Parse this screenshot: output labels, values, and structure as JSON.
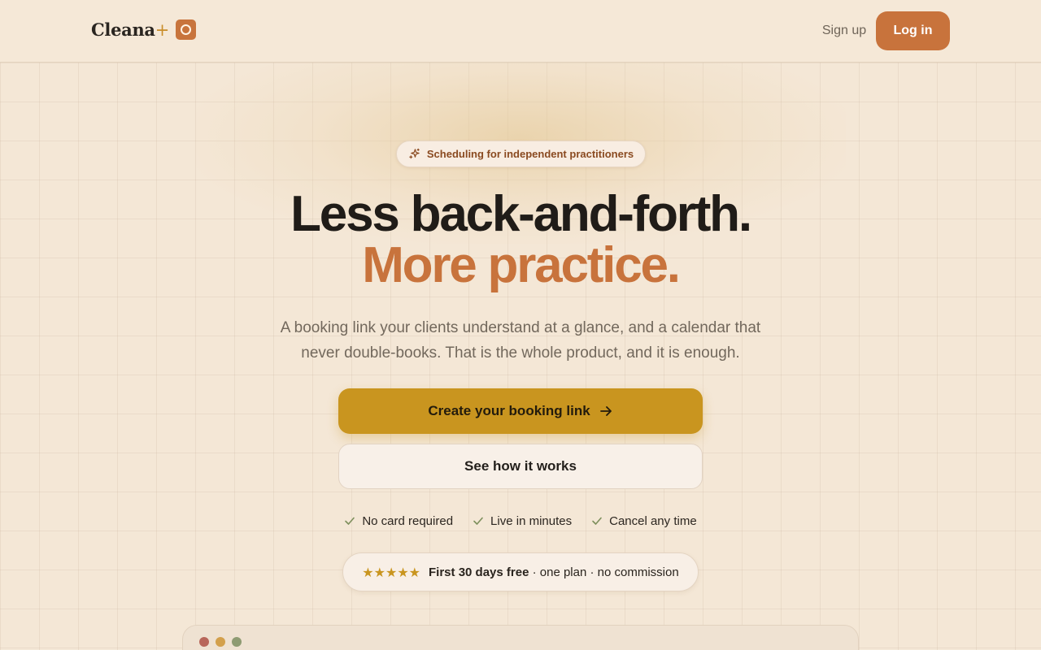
{
  "header": {
    "logo_text": "Cleana",
    "logo_plus": "+",
    "signup_label": "Sign up",
    "login_label": "Log in"
  },
  "hero": {
    "badge_icon": "sparkles-icon",
    "badge_text": "Scheduling for independent practitioners",
    "headline_line1": "Less back-and-forth.",
    "headline_line2": "More practice.",
    "subtitle": "A booking link your clients understand at a glance, and a calendar that never double-books. That is the whole product, and it is enough.",
    "primary_cta": "Create your booking link",
    "primary_cta_icon": "arrow-right-icon",
    "secondary_cta": "See how it works",
    "checks": [
      "No card required",
      "Live in minutes",
      "Cancel any time"
    ],
    "offer_stars": "★★★★★",
    "offer_bold": "First 30 days free",
    "offer_rest": "· one plan · no commission"
  },
  "colors": {
    "background": "#f4e7d6",
    "accent": "#c8733c",
    "primary_button": "#c9951f",
    "heading": "#201c18",
    "check": "#7d8f5c"
  }
}
